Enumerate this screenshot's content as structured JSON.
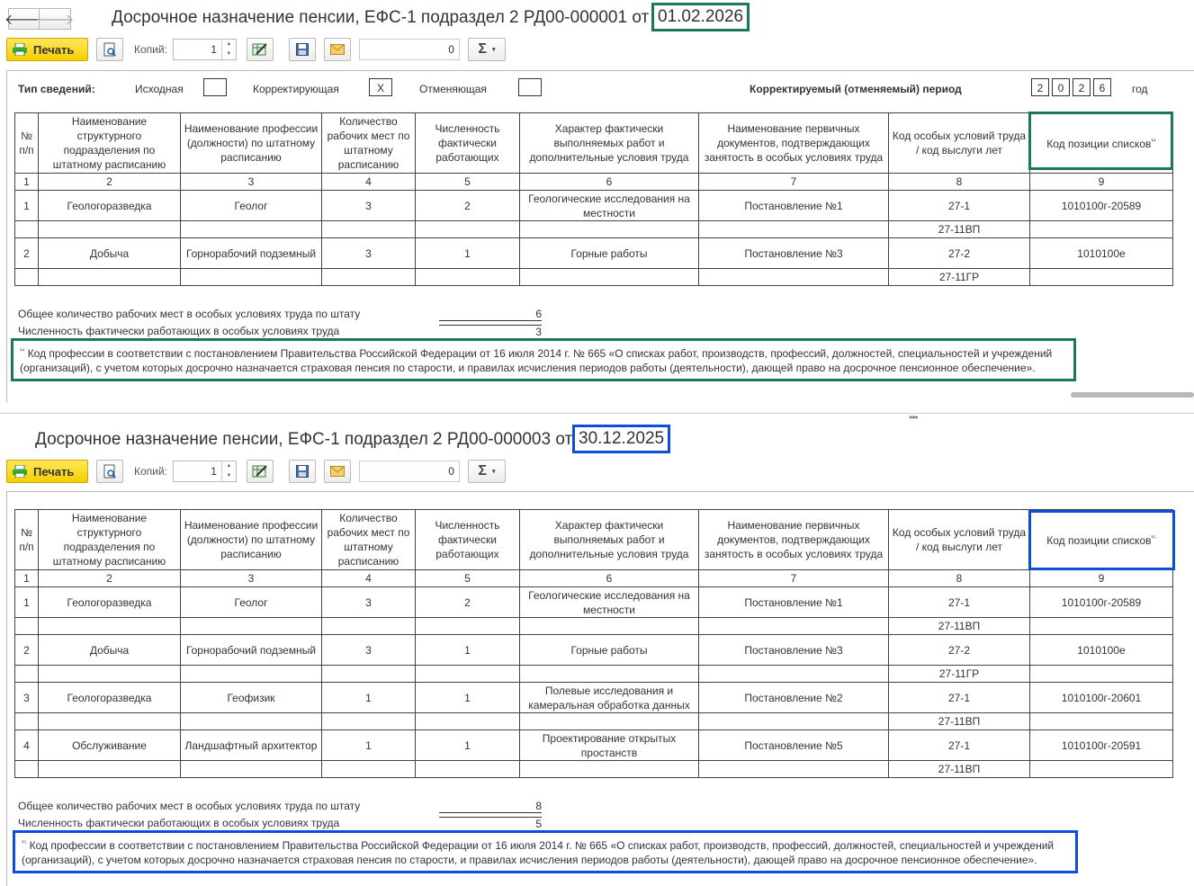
{
  "colors": {
    "doc1_highlight": "#1b7a55",
    "doc2_highlight": "#0b4fd6",
    "print_button": "#f5cf00"
  },
  "icons": {
    "back": "arrow-left-icon",
    "forward": "arrow-right-icon",
    "print": "printer-icon",
    "preview": "preview-icon",
    "edit": "edit-icon",
    "save": "save-icon",
    "mail": "mail-icon",
    "sum": "sigma-icon"
  },
  "common": {
    "print_label": "Печать",
    "copies_label": "Копий:",
    "copies_value": "1",
    "sum_value": "0",
    "sigma": "Σ",
    "dropdown": "▾",
    "arrow_up": "▲",
    "arrow_down": "▼",
    "back": "🡐",
    "forward": "🡒"
  },
  "headers": {
    "c1": "№ п/п",
    "c2": "Наименование структурного подразделения по штатному расписанию",
    "c3": "Наименование профессии (должности) по штатному расписанию",
    "c4": "Количество рабочих мест по штатному расписанию",
    "c5": "Численность фактически работающих",
    "c6": "Характер фактически выполняемых работ и дополнительные условия труда",
    "c7": "Наименование первичных документов, подтверждающих занятость в особых условиях труда",
    "c8": "Код особых условий труда / код выслуги лет",
    "c9": "Код позиции списков",
    "nums": [
      "1",
      "2",
      "3",
      "4",
      "5",
      "6",
      "7",
      "8",
      "9"
    ]
  },
  "doc1": {
    "title": "Досрочное назначение пенсии, ЕФС-1 подраздел 2 РД00-000001 от",
    "date": "01.02.2026",
    "info_type_label": "Тип сведений:",
    "type_initial": "Исходная",
    "type_initial_mark": "",
    "type_corrective": "Корректирующая",
    "type_corrective_mark": "X",
    "type_cancel": "Отменяющая",
    "type_cancel_mark": "",
    "period_label": "Корректируемый (отменяемый) период",
    "period_digits": [
      "2",
      "0",
      "2",
      "6"
    ],
    "period_suffix": "год",
    "footnote_ref": "¹⁴",
    "rows": [
      {
        "n": "1",
        "dept": "Геологоразведка",
        "prof": "Геолог",
        "places": "3",
        "workers": "2",
        "work": "Геологические исследования на местности",
        "docs": "Постановление №1",
        "code": "27-1",
        "code2": "27-11ВП",
        "pos": "1010100г-20589"
      },
      {
        "n": "2",
        "dept": "Добыча",
        "prof": "Горнорабочий подземный",
        "places": "3",
        "workers": "1",
        "work": "Горные работы",
        "docs": "Постановление №3",
        "code": "27-2",
        "code2": "27-11ГР",
        "pos": "1010100е"
      }
    ],
    "total_places_label": "Общее количество рабочих мест в особых условиях труда по штату",
    "total_places": "6",
    "total_workers_label": "Численность фактически работающих в особых условиях труда",
    "total_workers": "3",
    "footnote_num": "¹⁴",
    "footnote_text": "Код профессии в соответствии с постановлением Правительства Российской Федерации от 16 июля 2014 г. № 665 «О списках работ, производств, профессий, должностей, специальностей и учреждений (организаций), с учетом которых досрочно назначается страховая пенсия по старости, и правилах исчисления периодов работы (деятельности), дающей право на досрочное пенсионное обеспечение»."
  },
  "doc2": {
    "title": "Досрочное назначение пенсии, ЕФС-1 подраздел 2 РД00-000003 от",
    "date": "30.12.2025",
    "footnote_ref": "¹⁵",
    "rows": [
      {
        "n": "1",
        "dept": "Геологоразведка",
        "prof": "Геолог",
        "places": "3",
        "workers": "2",
        "work": "Геологические исследования на местности",
        "docs": "Постановление №1",
        "code": "27-1",
        "code2": "27-11ВП",
        "pos": "1010100г-20589"
      },
      {
        "n": "2",
        "dept": "Добыча",
        "prof": "Горнорабочий подземный",
        "places": "3",
        "workers": "1",
        "work": "Горные работы",
        "docs": "Постановление №3",
        "code": "27-2",
        "code2": "27-11ГР",
        "pos": "1010100е"
      },
      {
        "n": "3",
        "dept": "Геологоразведка",
        "prof": "Геофизик",
        "places": "1",
        "workers": "1",
        "work": "Полевые исследования и камеральная обработка данных",
        "docs": "Постановление №2",
        "code": "27-1",
        "code2": "27-11ВП",
        "pos": "1010100г-20601"
      },
      {
        "n": "4",
        "dept": "Обслуживание",
        "prof": "Ландшафтный архитектор",
        "places": "1",
        "workers": "1",
        "work": "Проектирование открытых простанств",
        "docs": "Постановление №5",
        "code": "27-1",
        "code2": "27-11ВП",
        "pos": "1010100г-20591"
      }
    ],
    "total_places_label": "Общее количество рабочих мест в особых условиях труда по штату",
    "total_places": "8",
    "total_workers_label": "Численность фактически работающих в особых условиях труда",
    "total_workers": "5",
    "footnote_num": "¹⁵",
    "footnote_text": "Код профессии в соответствии с постановлением Правительства Российской Федерации от 16 июля 2014 г. № 665 «О списках работ, производств, профессий, должностей, специальностей и учреждений (организаций), с учетом которых досрочно назначается страховая пенсия по старости, и правилах исчисления периодов работы (деятельности), дающей право на досрочное пенсионное обеспечение»."
  },
  "splitter": "•••"
}
